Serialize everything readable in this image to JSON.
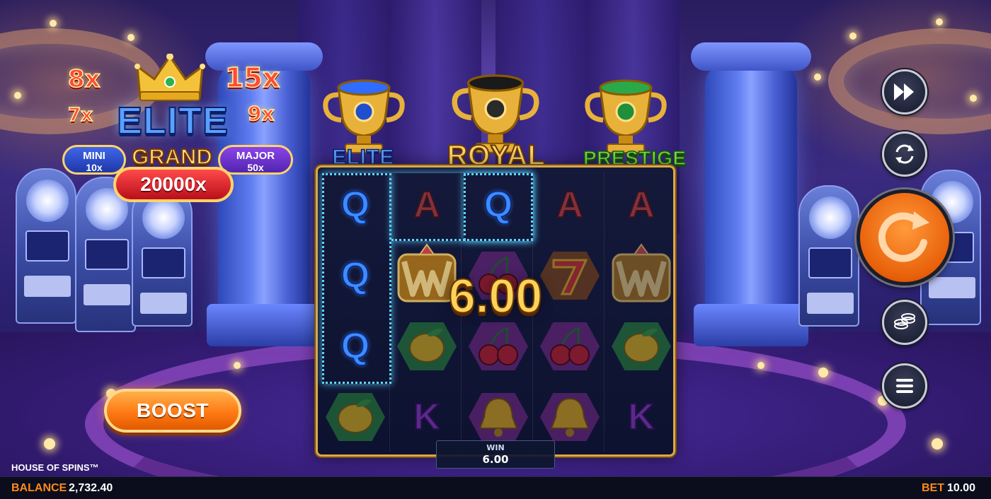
{
  "game": {
    "title": "HOUSE OF SPINS™"
  },
  "jackpots": {
    "logo_word": "ELITE",
    "multipliers": {
      "top_left": "8x",
      "mid_left": "7x",
      "top_right": "15x",
      "mid_right": "9x"
    },
    "mini": {
      "label": "MINI",
      "value": "10x"
    },
    "major": {
      "label": "MAJOR",
      "value": "50x"
    },
    "grand": {
      "label": "GRAND",
      "value": "20000x"
    }
  },
  "trophies": [
    {
      "label": "ELITE",
      "gem_color": "#2f6cff"
    },
    {
      "label": "ROYAL",
      "gem_color": "#1a1a1a"
    },
    {
      "label": "PRESTIGE",
      "gem_color": "#2aa84a"
    }
  ],
  "reels": [
    [
      "Q",
      "Q",
      "Q",
      "lemon"
    ],
    [
      "A",
      "wild",
      "lemon",
      "K"
    ],
    [
      "Q",
      "cherries",
      "cherries",
      "bell"
    ],
    [
      "A",
      "seven",
      "cherries",
      "bell"
    ],
    [
      "A",
      "wild",
      "lemon",
      "K"
    ]
  ],
  "win_amount_overlay": "6.00",
  "win_box": {
    "label": "WIN",
    "value": "6.00"
  },
  "buttons": {
    "boost": "BOOST",
    "fast_forward_icon": "fast-forward-icon",
    "autoplay_icon": "autoplay-icon",
    "spin_icon": "spin-arrow-icon",
    "coins_icon": "coins-icon",
    "menu_icon": "hamburger-menu-icon"
  },
  "footer": {
    "balance_label": "BALANCE",
    "balance_value": "2,732.40",
    "bet_label": "BET",
    "bet_value": "10.00"
  },
  "colors": {
    "accent_orange": "#ff8a1a",
    "reel_frame_gold": "#d9a84a",
    "win_highlight": "#5fd6ff"
  }
}
